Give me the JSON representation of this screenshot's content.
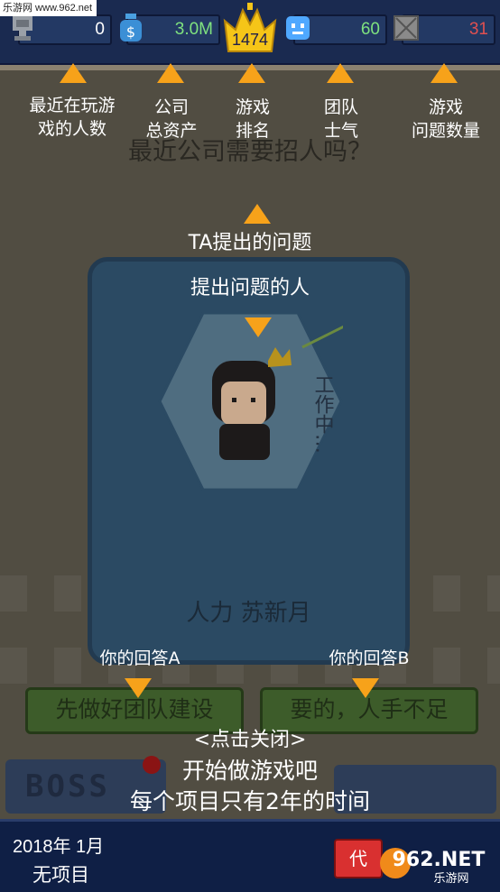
{
  "watermark": {
    "top_left": "乐游网 www.962.net",
    "logo_text": "962.NET",
    "logo_sub": "乐游网"
  },
  "stats": {
    "players": {
      "value": "0",
      "icon": "trophy-icon"
    },
    "assets": {
      "value": "3.0M",
      "icon": "money-bag-icon"
    },
    "rank": {
      "value": "1474",
      "icon": "crown-icon"
    },
    "morale": {
      "value": "60",
      "icon": "smiley-icon"
    },
    "issues": {
      "value": "31",
      "icon": "crossed-box-icon"
    }
  },
  "annotations": {
    "players": "最近在玩游\n戏的人数",
    "assets": "公司\n总资产",
    "rank": "游戏\n排名",
    "morale": "团队\n士气",
    "issues": "游戏\n问题数量",
    "question_note": "TA提出的问题",
    "asker_note": "提出问题的人",
    "answer_a_note": "你的回答A",
    "answer_b_note": "你的回答B",
    "tap_close": "<点击关闭>",
    "start_game": "开始做游戏吧",
    "two_years": "每个项目只有2年的时间"
  },
  "dialog": {
    "question": "最近公司需要招人吗？",
    "speaker": "人力 苏新月",
    "portrait_tag": "工作中…",
    "answer_a": "先做好团队建设",
    "answer_b": "要的，人手不足"
  },
  "bottom": {
    "date": "2018年 1月",
    "project": "无项目",
    "dai_button": "代"
  },
  "colors": {
    "accent": "#f7a21a",
    "topbar": "#1a2a50",
    "card": "#2b4a63",
    "answer": "#3d5c2a"
  }
}
